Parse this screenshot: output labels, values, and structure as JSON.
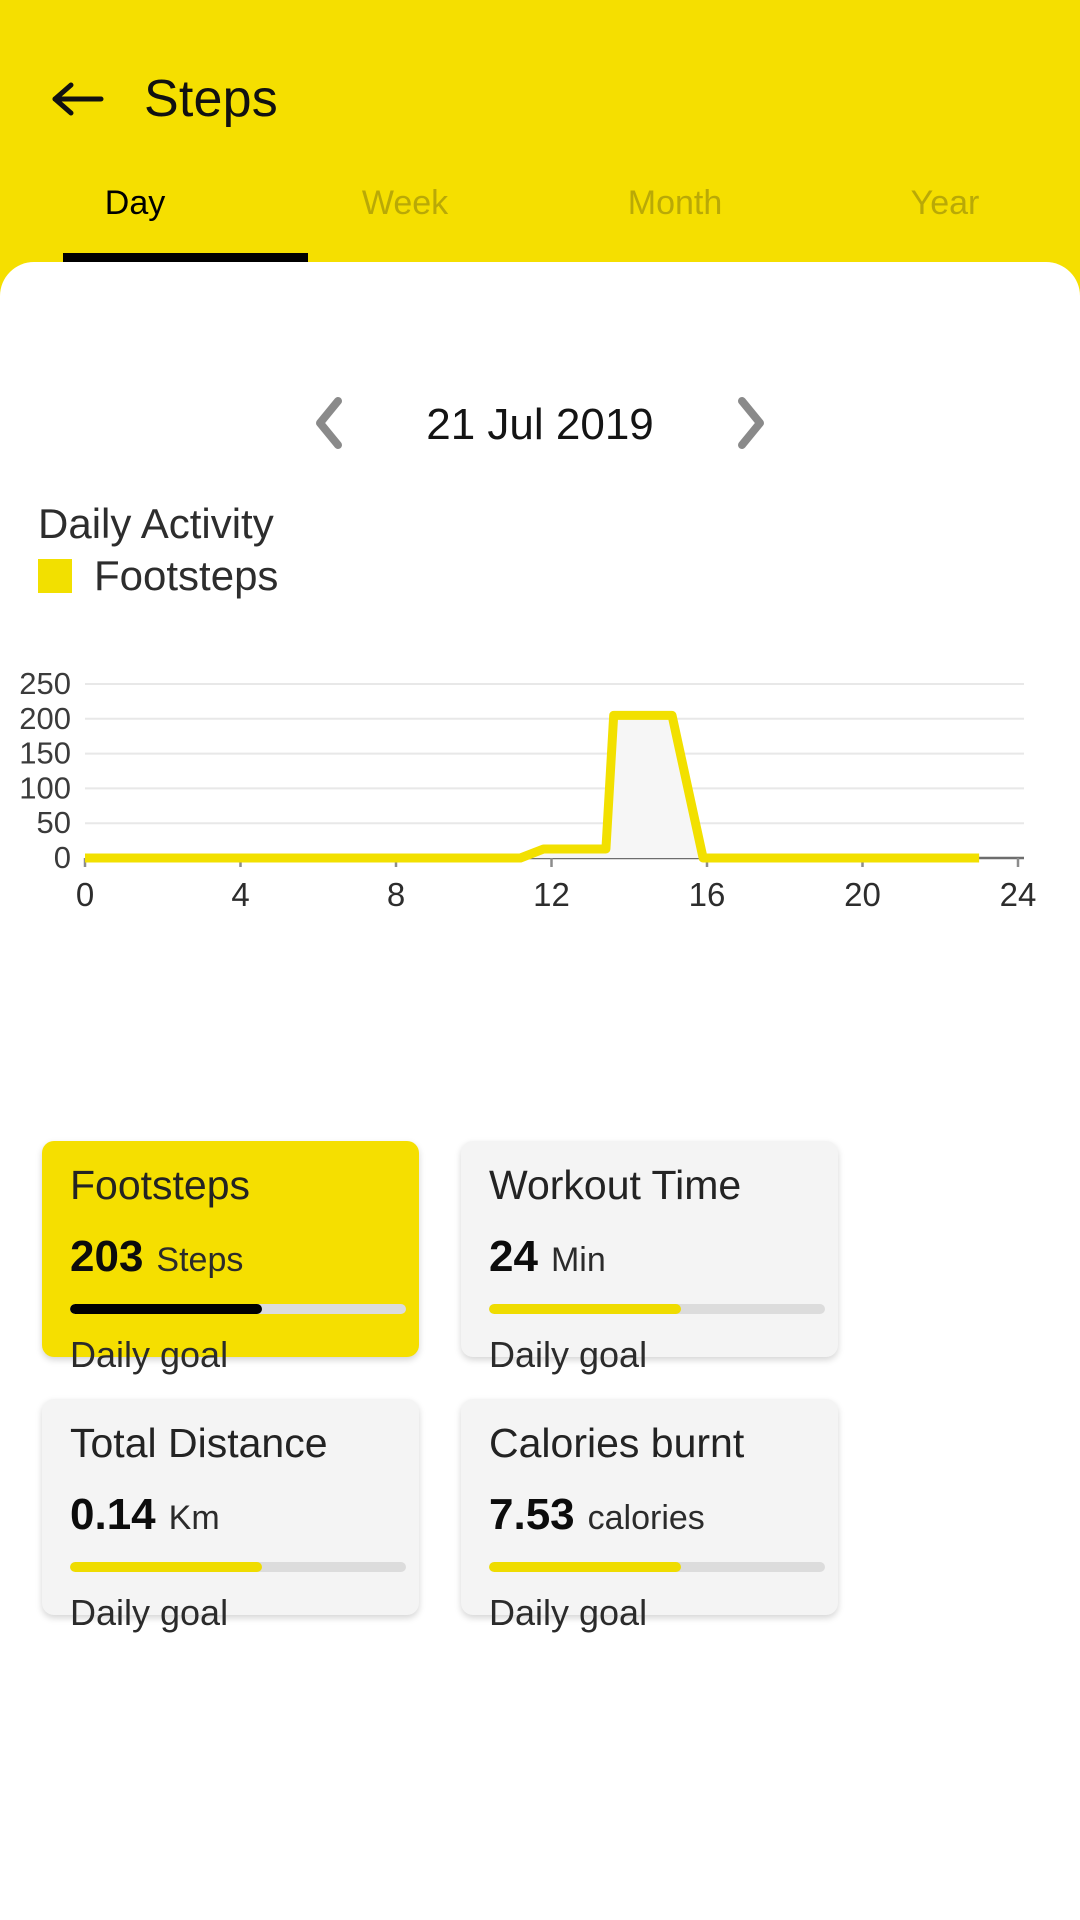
{
  "header": {
    "title": "Steps",
    "back_icon": "arrow-left-icon",
    "background_color": "#f5df00"
  },
  "tabs": {
    "items": [
      {
        "label": "Day",
        "active": true
      },
      {
        "label": "Week",
        "active": false
      },
      {
        "label": "Month",
        "active": false
      },
      {
        "label": "Year",
        "active": false
      }
    ]
  },
  "date_nav": {
    "prev_icon": "chevron-left-icon",
    "next_icon": "chevron-right-icon",
    "date": "21 Jul 2019"
  },
  "chart_header": {
    "title": "Daily Activity",
    "legend_label": "Footsteps",
    "legend_color": "#f2e000"
  },
  "chart_data": {
    "type": "area",
    "title": "Daily Activity",
    "xlabel": "",
    "ylabel": "",
    "xlim": [
      0,
      24
    ],
    "ylim": [
      0,
      250
    ],
    "xticks": [
      0,
      4,
      8,
      12,
      16,
      20,
      24
    ],
    "yticks": [
      0,
      50,
      100,
      150,
      200,
      250
    ],
    "grid": true,
    "legend_position": "top-left",
    "series": [
      {
        "name": "Footsteps",
        "color": "#f2e000",
        "x": [
          0,
          11.2,
          11.8,
          13.0,
          13.4,
          13.6,
          15.1,
          15.9,
          16.0,
          23.0
        ],
        "values": [
          0,
          0,
          13,
          13,
          13,
          205,
          205,
          0,
          0,
          0
        ]
      }
    ]
  },
  "cards": [
    {
      "title": "Footsteps",
      "value": "203",
      "unit": "Steps",
      "goal_label": "Daily goal",
      "progress_percent": 57,
      "accent": true
    },
    {
      "title": "Workout Time",
      "value": "24",
      "unit": "Min",
      "goal_label": "Daily goal",
      "progress_percent": 57,
      "accent": false
    },
    {
      "title": "Total Distance",
      "value": "0.14",
      "unit": "Km",
      "goal_label": "Daily goal",
      "progress_percent": 57,
      "accent": false
    },
    {
      "title": "Calories burnt",
      "value": "7.53",
      "unit": "calories",
      "goal_label": "Daily goal",
      "progress_percent": 57,
      "accent": false
    }
  ]
}
